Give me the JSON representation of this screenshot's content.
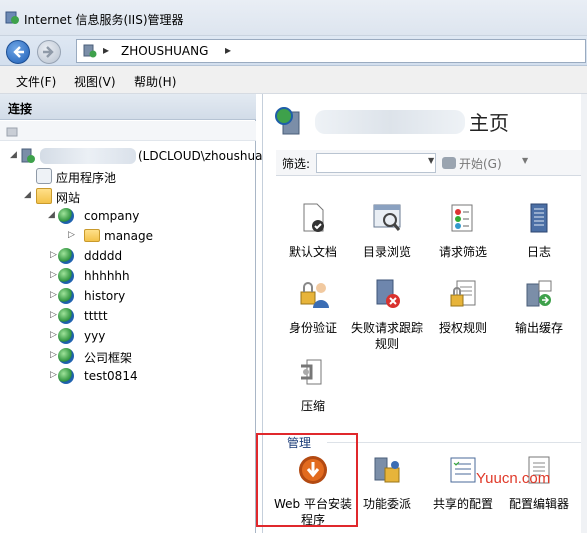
{
  "window": {
    "title": "Internet 信息服务(IIS)管理器"
  },
  "address": {
    "crumb": "ZHOUSHUANG",
    "sep1": "▸",
    "sep2": "▸"
  },
  "menu": [
    "文件(F)",
    "视图(V)",
    "帮助(H)"
  ],
  "left": {
    "header": "连接",
    "server_label": "(LDCLOUD\\zhoushua",
    "app_pool": "应用程序池",
    "sites": "网站",
    "site_items": [
      "company",
      "manage",
      "ddddd",
      "hhhhhh",
      "history",
      "ttttt",
      "yyy",
      "公司框架",
      "test0814"
    ]
  },
  "right": {
    "title": "主页",
    "filter_label": "筛选:",
    "go_label": "开始(G)",
    "features": [
      {
        "label": "默认文档",
        "icon": "default-document-icon"
      },
      {
        "label": "目录浏览",
        "icon": "directory-browsing-icon"
      },
      {
        "label": "请求筛选",
        "icon": "request-filtering-icon"
      },
      {
        "label": "日志",
        "icon": "logging-icon"
      },
      {
        "label": "身份验证",
        "icon": "authentication-icon"
      },
      {
        "label": "失败请求跟踪规则",
        "icon": "failed-request-tracing-icon"
      },
      {
        "label": "授权规则",
        "icon": "authorization-rules-icon"
      },
      {
        "label": "输出缓存",
        "icon": "output-caching-icon"
      },
      {
        "label": "压缩",
        "icon": "compression-icon"
      }
    ],
    "group_manage": "管理",
    "manage_features": [
      {
        "label": "Web 平台安装程序",
        "icon": "web-platform-installer-icon"
      },
      {
        "label": "功能委派",
        "icon": "feature-delegation-icon"
      },
      {
        "label": "共享的配置",
        "icon": "shared-configuration-icon"
      },
      {
        "label": "配置编辑器",
        "icon": "configuration-editor-icon"
      }
    ]
  },
  "watermark": "Yuucn.com",
  "colors": {
    "highlight": "#e0282c",
    "watermark": "#e03a2a",
    "group_header": "#1b3c78"
  }
}
